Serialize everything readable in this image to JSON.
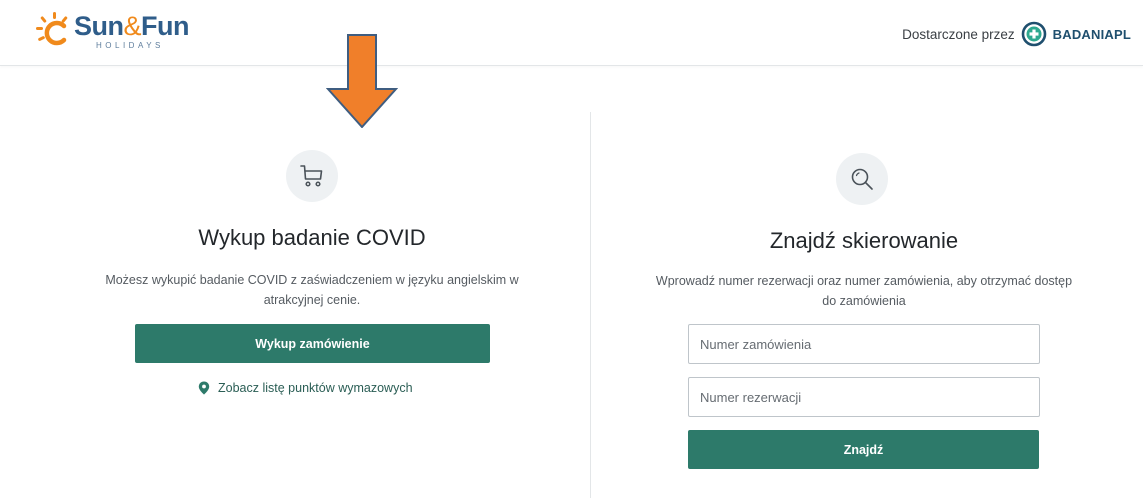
{
  "header": {
    "logo_word_a": "Sun",
    "logo_word_amp": "&",
    "logo_word_b": "Fun",
    "logo_sub": "HOLIDAYS",
    "provider_label": "Dostarczone przez",
    "provider_name": "BADANIAPL"
  },
  "purchase": {
    "icon": "shopping-cart-icon",
    "title": "Wykup badanie COVID",
    "description": "Możesz wykupić badanie COVID z zaświadczeniem w języku angielskim w atrakcyjnej cenie.",
    "button_label": "Wykup zamówienie",
    "link_icon": "location-pin-icon",
    "link_label": "Zobacz listę punktów wymazowych"
  },
  "find": {
    "icon": "search-icon",
    "title": "Znajdź skierowanie",
    "description": "Wprowadź numer rezerwacji oraz numer zamówienia, aby otrzymać dostęp do zamówienia",
    "order_placeholder": "Numer zamówienia",
    "order_value": "",
    "reservation_placeholder": "Numer rezerwacji",
    "reservation_value": "",
    "button_label": "Znajdź"
  },
  "annotation": {
    "arrow_color": "#f07f2a",
    "arrow_outline": "#3f5d80"
  },
  "colors": {
    "primary": "#2d7a6a",
    "brand_blue": "#2f5d8a",
    "brand_orange": "#f08a1c"
  }
}
